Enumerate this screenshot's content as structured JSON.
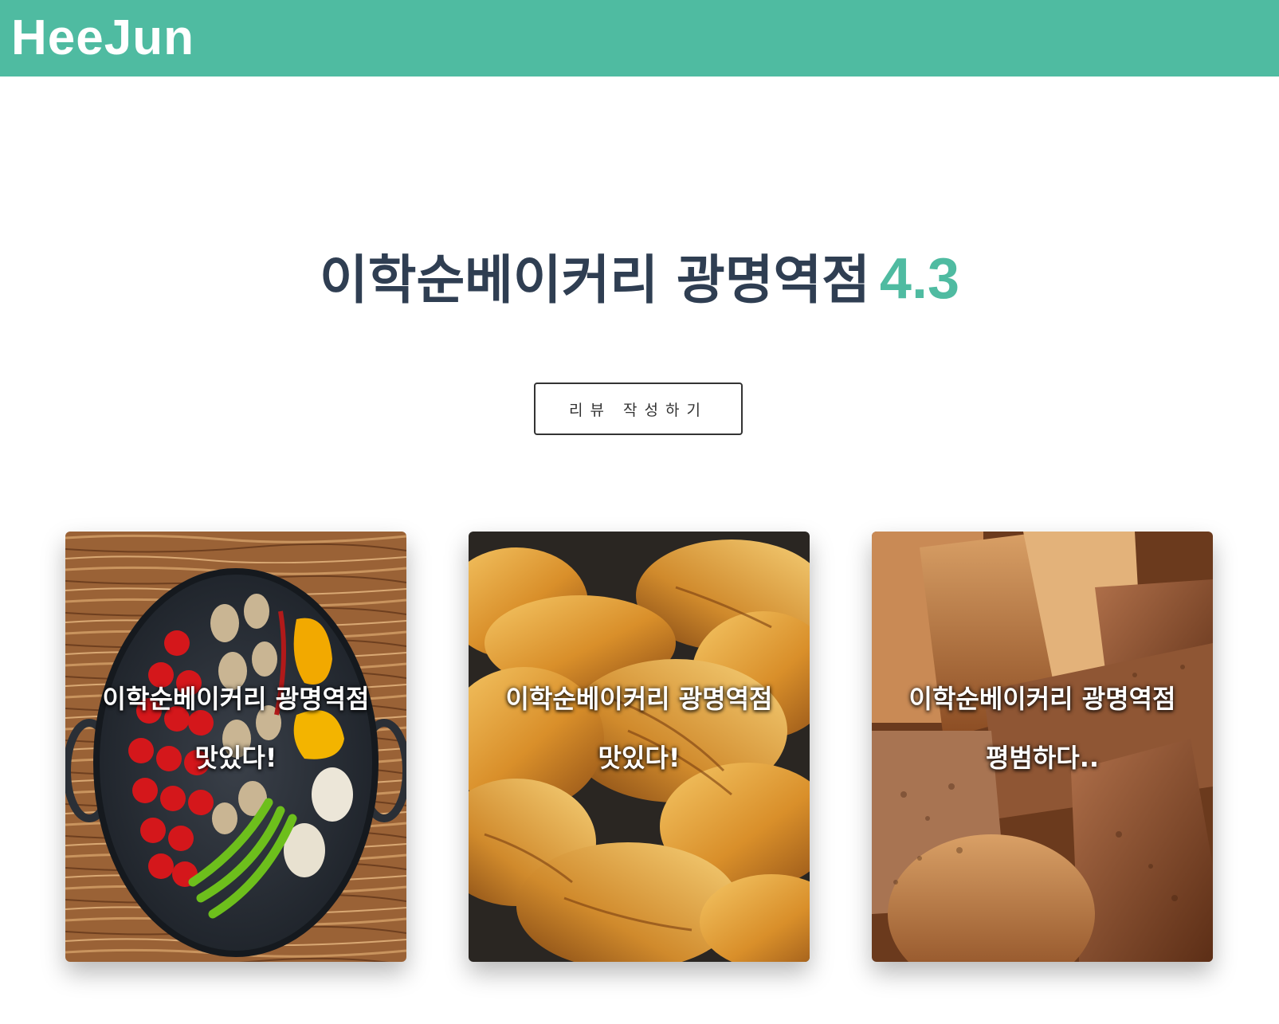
{
  "header": {
    "brand": "HeeJun",
    "color": "#4fbba1"
  },
  "store": {
    "name": "이학순베이커리 광명역점",
    "rating": "4.3",
    "name_color": "#2f3e52",
    "rating_color": "#4fbba1"
  },
  "actions": {
    "write_review": "리뷰 작성하기"
  },
  "reviews": [
    {
      "store": "이학순베이커리 광명역점",
      "comment": "맛있다!",
      "image": "vegetables-in-pan-on-wood"
    },
    {
      "store": "이학순베이커리 광명역점",
      "comment": "맛있다!",
      "image": "croissants"
    },
    {
      "store": "이학순베이커리 광명역점",
      "comment": "평범하다..",
      "image": "rustic-bread-loaves"
    }
  ]
}
